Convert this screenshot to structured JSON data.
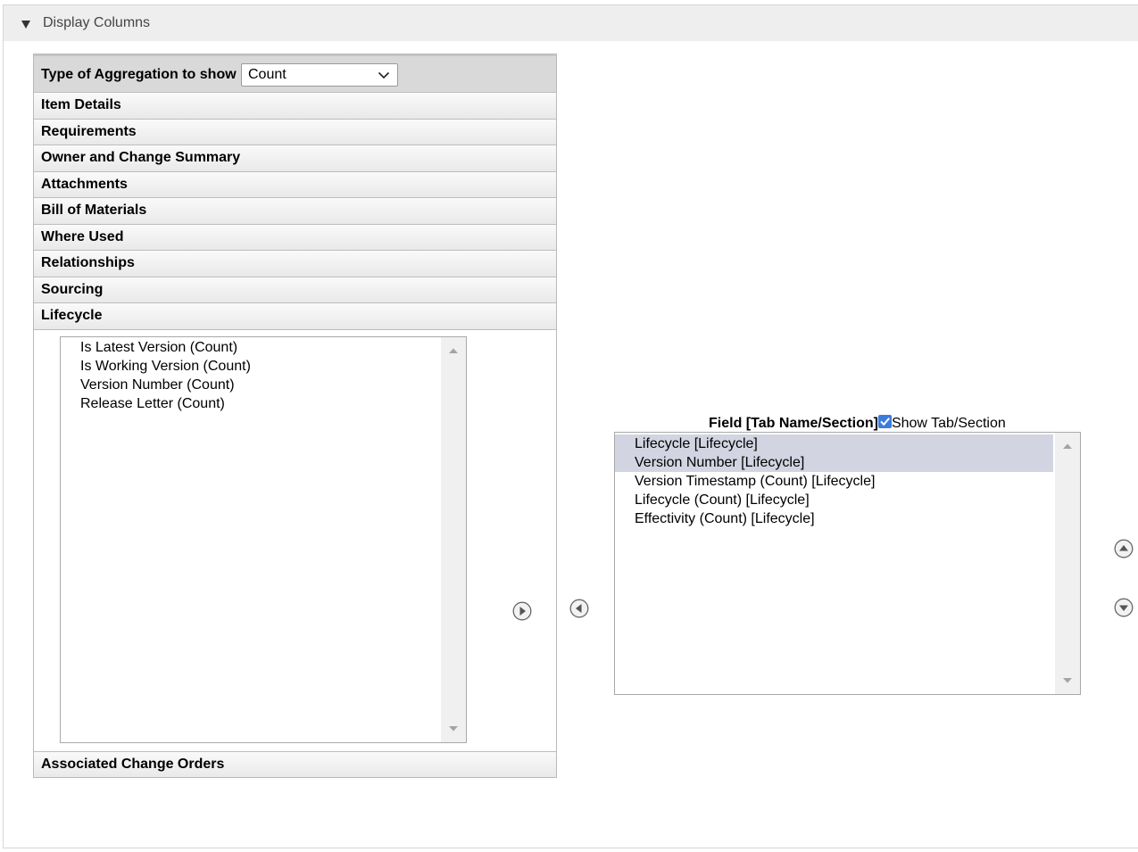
{
  "section": {
    "title": "Display Columns"
  },
  "aggregation": {
    "label": "Type of Aggregation to show",
    "selected": "Count"
  },
  "accordion": {
    "items": [
      {
        "label": "Item Details"
      },
      {
        "label": "Requirements"
      },
      {
        "label": "Owner and Change Summary"
      },
      {
        "label": "Attachments"
      },
      {
        "label": "Bill of Materials"
      },
      {
        "label": "Where Used"
      },
      {
        "label": "Relationships"
      },
      {
        "label": "Sourcing"
      },
      {
        "label": "Lifecycle"
      }
    ],
    "last_item": "Associated Change Orders",
    "available_fields": [
      "Is Latest Version (Count)",
      "Is Working Version (Count)",
      "Version Number (Count)",
      "Release Letter (Count)"
    ]
  },
  "selected_panel": {
    "header_label": "Field [Tab Name/Section]",
    "show_tab_label": "Show Tab/Section",
    "show_tab_checked": true,
    "fields": [
      {
        "label": "Lifecycle [Lifecycle]",
        "selected": true
      },
      {
        "label": "Version Number [Lifecycle]",
        "selected": true
      },
      {
        "label": "Version Timestamp (Count) [Lifecycle]",
        "selected": false
      },
      {
        "label": "Lifecycle (Count) [Lifecycle]",
        "selected": false
      },
      {
        "label": "Effectivity (Count) [Lifecycle]",
        "selected": false
      }
    ]
  },
  "colors": {
    "header_bg": "#eeeeee",
    "aggregation_bg": "#d9d9d9",
    "selection_bg": "#d2d5e1",
    "checkbox": "#3b7ddd"
  },
  "icons": {
    "toggle": "triangle-down-icon",
    "add": "arrow-right-circle-icon",
    "remove": "arrow-left-circle-icon",
    "move_up": "arrow-up-circle-icon",
    "move_down": "arrow-down-circle-icon"
  }
}
